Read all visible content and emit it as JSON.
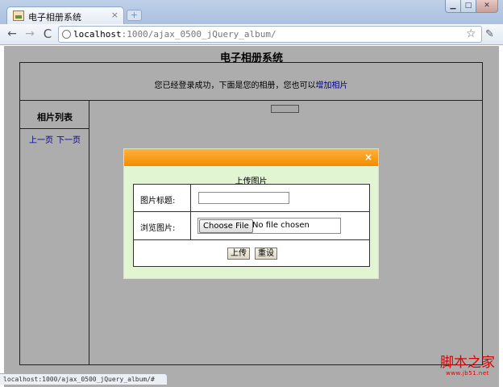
{
  "browser": {
    "tab_title": "电子相册系统",
    "tab_close": "×",
    "new_tab": "+",
    "window_min": "▁",
    "window_max": "□",
    "window_close": "✕",
    "nav": {
      "back": "←",
      "forward": "→",
      "reload": "C"
    },
    "url_scheme_host": "localhost",
    "url_rest": ":1000/ajax_0500_jQuery_album/",
    "star": "☆",
    "wrench": "✎",
    "status_url": "localhost:1000/ajax_0500_jQuery_album/#"
  },
  "page": {
    "title": "电子相册系统",
    "welcome_prefix": "您已经登录成功，下面是您的相册，您也可以",
    "add_photo_link": "增加相片",
    "sidebar_title": "相片列表",
    "pager": {
      "prev": "上一页",
      "next": "下一页"
    }
  },
  "dialog": {
    "close_glyph": "×",
    "caption": "上传图片",
    "title_label": "图片标题:",
    "title_value": "",
    "file_label": "浏览图片:",
    "choose_file": "Choose File",
    "file_status": "No file chosen",
    "upload_button": "上传",
    "reset_button": "重设"
  },
  "watermark": {
    "brand": "脚本之家",
    "url": "www.jb51.net"
  },
  "colors": {
    "dialog_bar": "#f28c00",
    "dialog_bg": "#e2f5d2",
    "link": "#0000cc",
    "watermark": "#dd0000"
  }
}
